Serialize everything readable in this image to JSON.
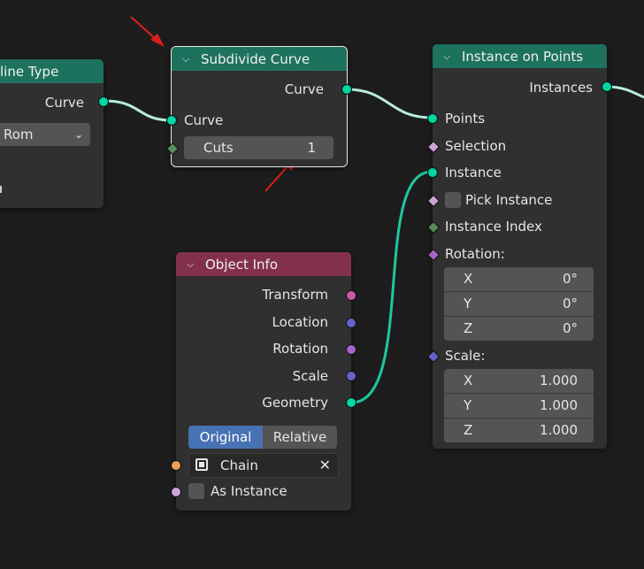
{
  "nodes": {
    "spline": {
      "title": "line Type",
      "out_curve": "Curve",
      "dropdown": "Rom"
    },
    "subdivide": {
      "title": "Subdivide Curve",
      "out_curve": "Curve",
      "in_curve": "Curve",
      "cuts_label": "Cuts",
      "cuts_value": "1"
    },
    "instance_on_points": {
      "title": "Instance on Points",
      "out_instances": "Instances",
      "in_points": "Points",
      "in_selection": "Selection",
      "in_instance": "Instance",
      "pick_instance": "Pick Instance",
      "instance_index": "Instance Index",
      "rotation": {
        "label": "Rotation:",
        "x_label": "X",
        "x_value": "0°",
        "y_label": "Y",
        "y_value": "0°",
        "z_label": "Z",
        "z_value": "0°"
      },
      "scale": {
        "label": "Scale:",
        "x_label": "X",
        "x_value": "1.000",
        "y_label": "Y",
        "y_value": "1.000",
        "z_label": "Z",
        "z_value": "1.000"
      }
    },
    "object_info": {
      "title": "Object Info",
      "outputs": [
        "Transform",
        "Location",
        "Rotation",
        "Scale",
        "Geometry"
      ],
      "mode_original": "Original",
      "mode_relative": "Relative",
      "object_name": "Chain",
      "as_instance": "As Instance"
    }
  },
  "colors": {
    "header_geometry": "#1d725e",
    "header_input": "#83314a",
    "geometry_socket": "#00d6a3",
    "annotation_arrow": "#e01e1e"
  }
}
